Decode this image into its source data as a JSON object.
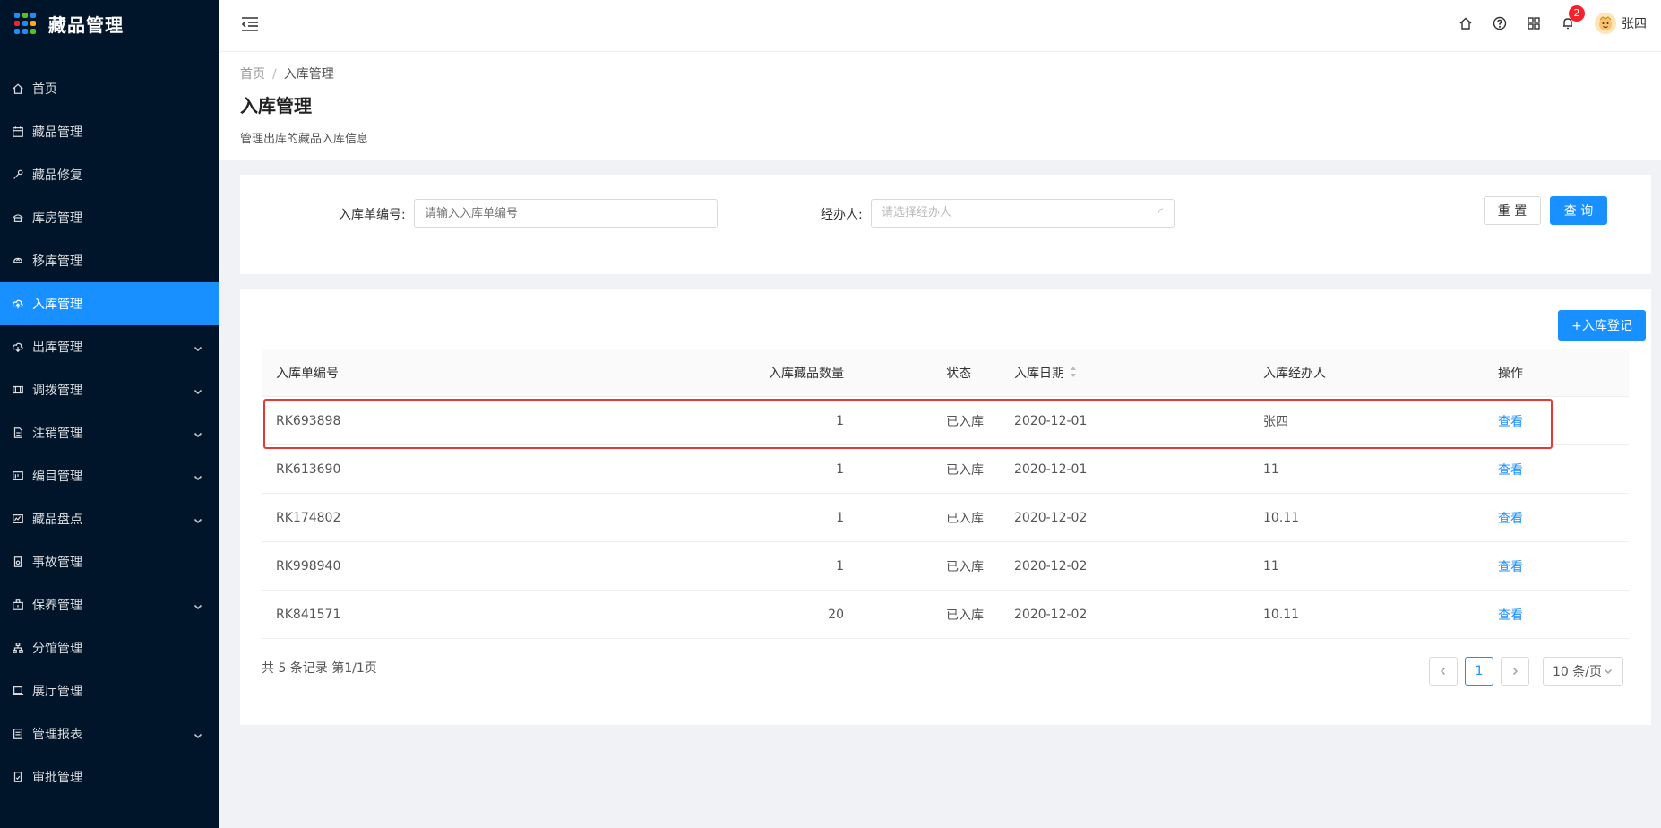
{
  "app": {
    "title": "藏品管理"
  },
  "colors": {
    "sidebar_bg": "#001529",
    "accent": "#1890ff",
    "highlight": "#e53935",
    "badge": "#f5222d"
  },
  "sidebar": {
    "items": [
      {
        "label": "首页",
        "icon": "home-icon",
        "has_arrow": false,
        "active": false
      },
      {
        "label": "藏品管理",
        "icon": "calendar-icon",
        "has_arrow": false,
        "active": false
      },
      {
        "label": "藏品修复",
        "icon": "wrench-icon",
        "has_arrow": false,
        "active": false
      },
      {
        "label": "库房管理",
        "icon": "warehouse-icon",
        "has_arrow": false,
        "active": false
      },
      {
        "label": "移库管理",
        "icon": "transfer-icon",
        "has_arrow": false,
        "active": false
      },
      {
        "label": "入库管理",
        "icon": "cloud-upload-icon",
        "has_arrow": false,
        "active": true
      },
      {
        "label": "出库管理",
        "icon": "cloud-download-icon",
        "has_arrow": true,
        "active": false
      },
      {
        "label": "调拨管理",
        "icon": "swap-icon",
        "has_arrow": true,
        "active": false
      },
      {
        "label": "注销管理",
        "icon": "file-icon",
        "has_arrow": true,
        "active": false
      },
      {
        "label": "编目管理",
        "icon": "catalog-icon",
        "has_arrow": true,
        "active": false
      },
      {
        "label": "藏品盘点",
        "icon": "inventory-icon",
        "has_arrow": true,
        "active": false
      },
      {
        "label": "事故管理",
        "icon": "accident-icon",
        "has_arrow": false,
        "active": false
      },
      {
        "label": "保养管理",
        "icon": "maintenance-icon",
        "has_arrow": true,
        "active": false
      },
      {
        "label": "分馆管理",
        "icon": "branch-icon",
        "has_arrow": false,
        "active": false
      },
      {
        "label": "展厅管理",
        "icon": "laptop-icon",
        "has_arrow": false,
        "active": false
      },
      {
        "label": "管理报表",
        "icon": "report-icon",
        "has_arrow": true,
        "active": false
      },
      {
        "label": "审批管理",
        "icon": "approval-icon",
        "has_arrow": false,
        "active": false
      }
    ]
  },
  "header": {
    "notification_count": "2",
    "username": "张四"
  },
  "page": {
    "breadcrumb": [
      "首页",
      "入库管理"
    ],
    "title": "入库管理",
    "description": "管理出库的藏品入库信息"
  },
  "search": {
    "order_no_label": "入库单编号:",
    "order_no_placeholder": "请输入入库单编号",
    "handler_label": "经办人:",
    "handler_placeholder": "请选择经办人",
    "reset_label": "重 置",
    "query_label": "查 询"
  },
  "table": {
    "add_label": "+入库登记",
    "columns": [
      "入库单编号",
      "入库藏品数量",
      "状态",
      "入库日期",
      "入库经办人",
      "操作"
    ],
    "rows": [
      {
        "no": "RK693898",
        "count": "1",
        "status": "已入库",
        "date": "2020-12-01",
        "handler": "张四",
        "action": "查看"
      },
      {
        "no": "RK613690",
        "count": "1",
        "status": "已入库",
        "date": "2020-12-01",
        "handler": "11",
        "action": "查看"
      },
      {
        "no": "RK174802",
        "count": "1",
        "status": "已入库",
        "date": "2020-12-02",
        "handler": "10.11",
        "action": "查看"
      },
      {
        "no": "RK998940",
        "count": "1",
        "status": "已入库",
        "date": "2020-12-02",
        "handler": "11",
        "action": "查看"
      },
      {
        "no": "RK841571",
        "count": "20",
        "status": "已入库",
        "date": "2020-12-02",
        "handler": "10.11",
        "action": "查看"
      }
    ]
  },
  "pagination": {
    "summary": "共 5 条记录 第1/1页",
    "current_page": "1",
    "page_size": "10 条/页"
  }
}
